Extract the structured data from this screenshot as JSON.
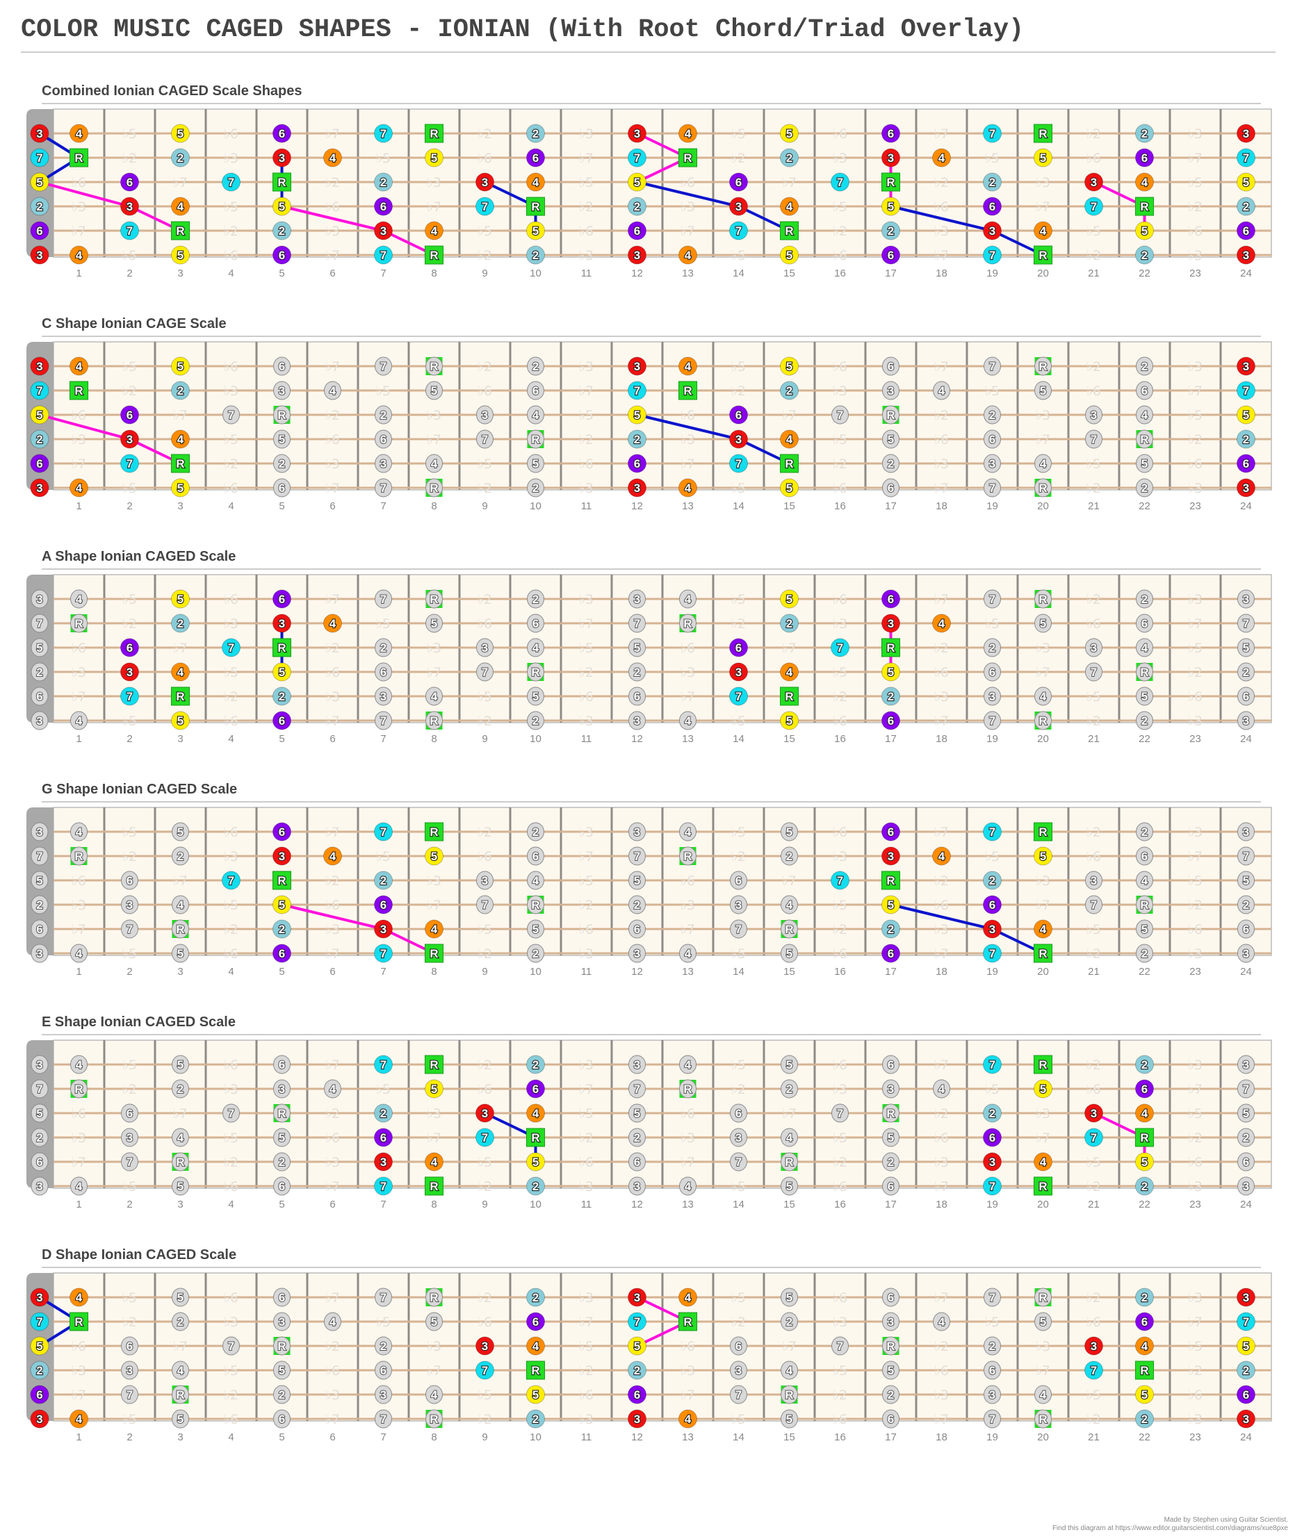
{
  "title": "COLOR MUSIC CAGED SHAPES - IONIAN (With Root Chord/Triad Overlay)",
  "tuning_open_degrees": [
    "3",
    "7",
    "5",
    "2",
    "6",
    "3"
  ],
  "chromatic": [
    "R",
    "b2",
    "2",
    "b3",
    "3",
    "4",
    "b5",
    "5",
    "b6",
    "6",
    "b7",
    "7"
  ],
  "scale_degrees": [
    "R",
    "2",
    "3",
    "4",
    "5",
    "6",
    "7"
  ],
  "fret_count": 24,
  "fret_numbers": [
    "1",
    "2",
    "3",
    "4",
    "5",
    "6",
    "7",
    "8",
    "9",
    "10",
    "11",
    "12",
    "13",
    "14",
    "15",
    "16",
    "17",
    "18",
    "19",
    "20",
    "21",
    "22",
    "23",
    "24"
  ],
  "degree_colors": {
    "R": "#22dd22",
    "2": "#88ccd8",
    "3": "#ee1111",
    "4": "#ff8c00",
    "5": "#ffee00",
    "6": "#8800ee",
    "7": "#11ddee"
  },
  "inactive_color": "#d8d8d8",
  "line_colors": {
    "blue": "#0a14cc",
    "magenta": "#ff11dd"
  },
  "sections": [
    {
      "title": "Combined Ionian CAGED Scale Shapes",
      "active": {
        "s1": [
          0,
          1,
          3,
          5,
          7,
          8,
          10,
          12,
          13,
          15,
          17,
          19,
          20,
          22,
          24
        ],
        "s2": [
          0,
          1,
          3,
          5,
          6,
          8,
          10,
          12,
          13,
          15,
          17,
          18,
          20,
          22,
          24
        ],
        "s3": [
          0,
          2,
          4,
          5,
          7,
          9,
          10,
          12,
          14,
          16,
          17,
          19,
          21,
          22,
          24
        ],
        "s4": [
          0,
          2,
          3,
          5,
          7,
          9,
          10,
          12,
          14,
          15,
          17,
          19,
          21,
          22,
          24
        ],
        "s5": [
          0,
          2,
          3,
          5,
          7,
          8,
          10,
          12,
          14,
          15,
          17,
          19,
          20,
          22,
          24
        ],
        "s6": [
          0,
          1,
          3,
          5,
          7,
          8,
          10,
          12,
          13,
          15,
          17,
          19,
          20,
          22,
          24
        ]
      },
      "triads": [
        {
          "color": "blue",
          "notes": [
            [
              1,
              0
            ],
            [
              2,
              1
            ],
            [
              3,
              0
            ]
          ]
        },
        {
          "color": "magenta",
          "notes": [
            [
              3,
              0
            ],
            [
              4,
              2
            ],
            [
              5,
              3
            ]
          ]
        },
        {
          "color": "blue",
          "notes": [
            [
              2,
              5
            ],
            [
              3,
              5
            ],
            [
              4,
              5
            ]
          ]
        },
        {
          "color": "magenta",
          "notes": [
            [
              4,
              5
            ],
            [
              5,
              7
            ],
            [
              6,
              8
            ]
          ]
        },
        {
          "color": "blue",
          "notes": [
            [
              3,
              9
            ],
            [
              4,
              10
            ],
            [
              5,
              10
            ]
          ]
        },
        {
          "color": "magenta",
          "notes": [
            [
              1,
              12
            ],
            [
              2,
              13
            ],
            [
              3,
              12
            ]
          ]
        },
        {
          "color": "blue",
          "notes": [
            [
              3,
              12
            ],
            [
              4,
              14
            ],
            [
              5,
              15
            ]
          ]
        },
        {
          "color": "magenta",
          "notes": [
            [
              2,
              17
            ],
            [
              3,
              17
            ],
            [
              4,
              17
            ]
          ]
        },
        {
          "color": "blue",
          "notes": [
            [
              4,
              17
            ],
            [
              5,
              19
            ],
            [
              6,
              20
            ]
          ]
        },
        {
          "color": "magenta",
          "notes": [
            [
              3,
              21
            ],
            [
              4,
              22
            ],
            [
              5,
              22
            ]
          ]
        }
      ]
    },
    {
      "title": "C Shape Ionian CAGE Scale",
      "active": {
        "s1": [
          0,
          1,
          3,
          12,
          13,
          15,
          24
        ],
        "s2": [
          0,
          1,
          3,
          12,
          13,
          15,
          24
        ],
        "s3": [
          0,
          2,
          12,
          14,
          24
        ],
        "s4": [
          0,
          2,
          3,
          12,
          14,
          15,
          24
        ],
        "s5": [
          0,
          2,
          3,
          12,
          14,
          15,
          24
        ],
        "s6": [
          0,
          1,
          3,
          12,
          13,
          15,
          24
        ]
      },
      "triads": [
        {
          "color": "magenta",
          "notes": [
            [
              3,
              0
            ],
            [
              4,
              2
            ],
            [
              5,
              3
            ]
          ]
        },
        {
          "color": "blue",
          "notes": [
            [
              3,
              12
            ],
            [
              4,
              14
            ],
            [
              5,
              15
            ]
          ]
        }
      ]
    },
    {
      "title": "A Shape Ionian CAGED Scale",
      "active": {
        "s1": [
          3,
          5,
          15,
          17
        ],
        "s2": [
          3,
          5,
          6,
          15,
          17,
          18
        ],
        "s3": [
          2,
          4,
          5,
          14,
          16,
          17
        ],
        "s4": [
          2,
          3,
          5,
          14,
          15,
          17
        ],
        "s5": [
          2,
          3,
          5,
          14,
          15,
          17
        ],
        "s6": [
          3,
          5,
          15,
          17
        ]
      },
      "triads": [
        {
          "color": "blue",
          "notes": [
            [
              2,
              5
            ],
            [
              3,
              5
            ],
            [
              4,
              5
            ]
          ]
        },
        {
          "color": "magenta",
          "notes": [
            [
              2,
              17
            ],
            [
              3,
              17
            ],
            [
              4,
              17
            ]
          ]
        }
      ]
    },
    {
      "title": "G Shape Ionian CAGED Scale",
      "active": {
        "s1": [
          5,
          7,
          8,
          17,
          19,
          20
        ],
        "s2": [
          5,
          6,
          8,
          17,
          18,
          20
        ],
        "s3": [
          4,
          5,
          7,
          16,
          17,
          19
        ],
        "s4": [
          5,
          7,
          17,
          19
        ],
        "s5": [
          5,
          7,
          8,
          17,
          19,
          20
        ],
        "s6": [
          5,
          7,
          8,
          17,
          19,
          20
        ]
      },
      "triads": [
        {
          "color": "magenta",
          "notes": [
            [
              4,
              5
            ],
            [
              5,
              7
            ],
            [
              6,
              8
            ]
          ]
        },
        {
          "color": "blue",
          "notes": [
            [
              4,
              17
            ],
            [
              5,
              19
            ],
            [
              6,
              20
            ]
          ]
        }
      ]
    },
    {
      "title": "E Shape Ionian CAGED Scale",
      "active": {
        "s1": [
          7,
          8,
          10,
          19,
          20,
          22
        ],
        "s2": [
          8,
          10,
          20,
          22
        ],
        "s3": [
          7,
          9,
          10,
          19,
          21,
          22
        ],
        "s4": [
          7,
          9,
          10,
          19,
          21,
          22
        ],
        "s5": [
          7,
          8,
          10,
          19,
          20,
          22
        ],
        "s6": [
          7,
          8,
          10,
          19,
          20,
          22
        ]
      },
      "triads": [
        {
          "color": "blue",
          "notes": [
            [
              3,
              9
            ],
            [
              4,
              10
            ],
            [
              5,
              10
            ]
          ]
        },
        {
          "color": "magenta",
          "notes": [
            [
              3,
              21
            ],
            [
              4,
              22
            ],
            [
              5,
              22
            ]
          ]
        }
      ]
    },
    {
      "title": "D Shape Ionian CAGED Scale",
      "active": {
        "s1": [
          0,
          1,
          10,
          12,
          13,
          22,
          24
        ],
        "s2": [
          0,
          1,
          10,
          12,
          13,
          22,
          24
        ],
        "s3": [
          0,
          9,
          10,
          12,
          21,
          22,
          24
        ],
        "s4": [
          0,
          9,
          10,
          12,
          21,
          22,
          24
        ],
        "s5": [
          0,
          10,
          12,
          22,
          24
        ],
        "s6": [
          0,
          1,
          10,
          12,
          13,
          22,
          24
        ]
      },
      "triads": [
        {
          "color": "blue",
          "notes": [
            [
              1,
              0
            ],
            [
              2,
              1
            ],
            [
              3,
              0
            ]
          ]
        },
        {
          "color": "magenta",
          "notes": [
            [
              1,
              12
            ],
            [
              2,
              13
            ],
            [
              3,
              12
            ]
          ]
        }
      ]
    }
  ],
  "footer": {
    "line1": "Made by Stephen using Guitar Scientist.",
    "line2": "Find this diagram at https://www.editor.guitarscientist.com/diagrams/xue8pxe"
  }
}
